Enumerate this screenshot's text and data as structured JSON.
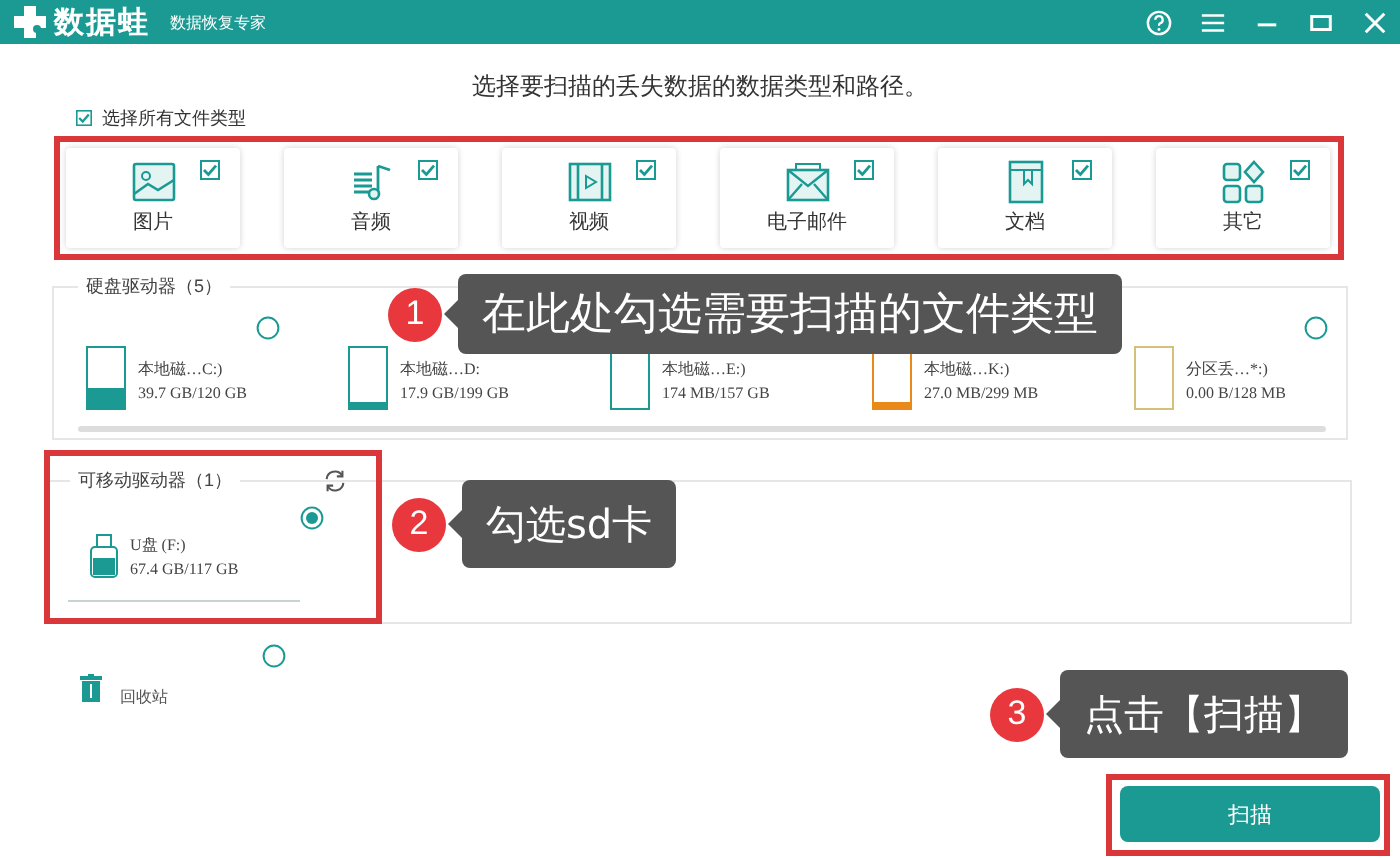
{
  "window": {
    "app_name": "数据蛙",
    "subtitle": "数据恢复专家"
  },
  "heading": "选择要扫描的丢失数据的数据类型和路径。",
  "select_all": {
    "label": "选择所有文件类型",
    "checked": true
  },
  "file_types": [
    {
      "label": "图片",
      "checked": true,
      "kind": "image"
    },
    {
      "label": "音频",
      "checked": true,
      "kind": "audio"
    },
    {
      "label": "视频",
      "checked": true,
      "kind": "video"
    },
    {
      "label": "电子邮件",
      "checked": true,
      "kind": "email"
    },
    {
      "label": "文档",
      "checked": true,
      "kind": "document"
    },
    {
      "label": "其它",
      "checked": true,
      "kind": "other"
    }
  ],
  "hard_drives": {
    "title": "硬盘驱动器（5）",
    "drives": [
      {
        "name": "本地磁…C:)",
        "usage": "39.7 GB/120 GB",
        "level": 0.33,
        "color": "#1a9a93",
        "selected": false
      },
      {
        "name": "本地磁…D:",
        "usage": "17.9 GB/199 GB",
        "level": 0.1,
        "color": "#1a9a93"
      },
      {
        "name": "本地磁…E:)",
        "usage": "174 MB/157 GB",
        "color": "#1a9a93"
      },
      {
        "name": "本地磁…K:)",
        "usage": "27.0 MB/299 MB",
        "level": 0.1,
        "color": "#e8891a"
      },
      {
        "name": "分区丢…*:)",
        "usage": "0.00  B/128 MB",
        "color": "#d4c07a",
        "selected": false
      }
    ]
  },
  "removable": {
    "title": "可移动驱动器（1）",
    "drives": [
      {
        "name": "U盘 (F:)",
        "usage": "67.4 GB/117 GB",
        "selected": true
      }
    ]
  },
  "recycle_bin": {
    "label": "回收站",
    "selected": false
  },
  "scan_button": "扫描",
  "callouts": [
    {
      "number": "1",
      "text": "在此处勾选需要扫描的文件类型"
    },
    {
      "number": "2",
      "text": "勾选sd卡"
    },
    {
      "number": "3",
      "text": "点击【扫描】"
    }
  ]
}
